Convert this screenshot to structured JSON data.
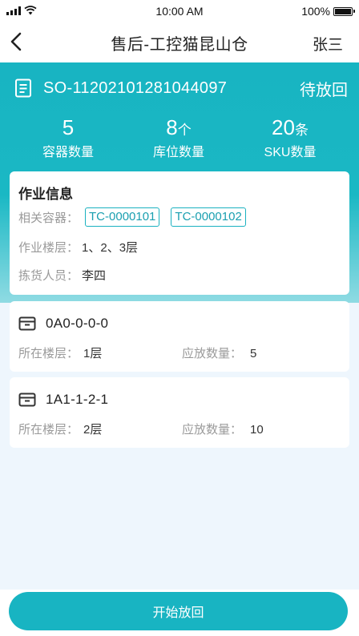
{
  "status_bar": {
    "time": "10:00 AM",
    "battery": "100%"
  },
  "nav": {
    "title": "售后-工控猫昆山仓",
    "user": "张三"
  },
  "order": {
    "number": "SO-11202101281044097",
    "status": "待放回"
  },
  "stats": [
    {
      "value": "5",
      "unit": "",
      "label": "容器数量"
    },
    {
      "value": "8",
      "unit": "个",
      "label": "库位数量"
    },
    {
      "value": "20",
      "unit": "条",
      "label": "SKU数量"
    }
  ],
  "job_info": {
    "title": "作业信息",
    "containers_label": "相关容器：",
    "containers": [
      "TC-0000101",
      "TC-0000102"
    ],
    "floors_label": "作业楼层：",
    "floors_value": "1、2、3层",
    "picker_label": "拣货人员：",
    "picker_value": "李四"
  },
  "locations": [
    {
      "code": "0A0-0-0-0",
      "floor_label": "所在楼层：",
      "floor_value": "1层",
      "qty_label": "应放数量：",
      "qty_value": "5"
    },
    {
      "code": "1A1-1-2-1",
      "floor_label": "所在楼层：",
      "floor_value": "2层",
      "qty_label": "应放数量：",
      "qty_value": "10"
    }
  ],
  "actions": {
    "start_label": "开始放回"
  },
  "colors": {
    "primary": "#18b4c2",
    "page_background": "#eef6fd"
  },
  "icons": [
    "signal-icon",
    "wifi-icon",
    "battery-icon",
    "back-arrow-icon",
    "document-icon",
    "box-icon"
  ]
}
